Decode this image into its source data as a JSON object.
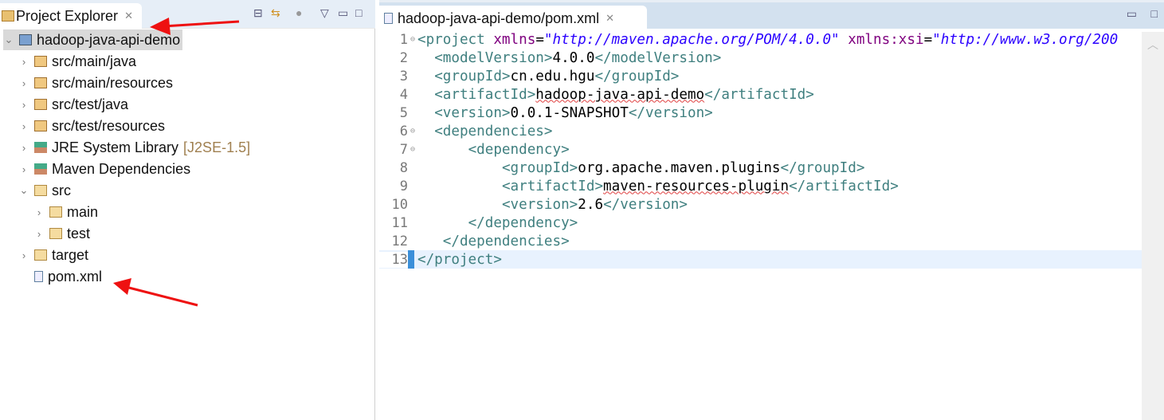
{
  "explorer": {
    "title": "Project Explorer",
    "items": [
      {
        "label": "hadoop-java-api-demo",
        "depth": 0,
        "expanded": true,
        "icon": "maven-project-icon",
        "selected": true
      },
      {
        "label": "src/main/java",
        "depth": 1,
        "expanded": false,
        "icon": "package-folder-icon"
      },
      {
        "label": "src/main/resources",
        "depth": 1,
        "expanded": false,
        "icon": "package-folder-icon"
      },
      {
        "label": "src/test/java",
        "depth": 1,
        "expanded": false,
        "icon": "package-folder-icon"
      },
      {
        "label": "src/test/resources",
        "depth": 1,
        "expanded": false,
        "icon": "package-folder-icon"
      },
      {
        "label": "JRE System Library",
        "suffix": "[J2SE-1.5]",
        "depth": 1,
        "expanded": false,
        "icon": "library-icon"
      },
      {
        "label": "Maven Dependencies",
        "depth": 1,
        "expanded": false,
        "icon": "library-icon"
      },
      {
        "label": "src",
        "depth": 1,
        "expanded": true,
        "icon": "folder-icon"
      },
      {
        "label": "main",
        "depth": 2,
        "expanded": false,
        "icon": "folder-icon"
      },
      {
        "label": "test",
        "depth": 2,
        "expanded": false,
        "icon": "folder-icon"
      },
      {
        "label": "target",
        "depth": 1,
        "expanded": false,
        "icon": "folder-icon"
      },
      {
        "label": "pom.xml",
        "depth": 1,
        "icon": "xml-file-icon"
      }
    ]
  },
  "editor": {
    "tab_label": "hadoop-java-api-demo/pom.xml",
    "lines": [
      {
        "n": "1",
        "fold": true,
        "tokens": [
          [
            "tag",
            "<project "
          ],
          [
            "att",
            "xmlns"
          ],
          [
            "pl",
            "="
          ],
          [
            "str",
            "\"http://maven.apache.org/POM/4.0.0\""
          ],
          [
            "pl",
            " "
          ],
          [
            "att",
            "xmlns:xsi"
          ],
          [
            "pl",
            "="
          ],
          [
            "str",
            "\"http://www.w3.org/200"
          ]
        ]
      },
      {
        "n": "2",
        "tokens": [
          [
            "pl",
            "  "
          ],
          [
            "tag",
            "<modelVersion>"
          ],
          [
            "pl",
            "4.0.0"
          ],
          [
            "tag",
            "</modelVersion>"
          ]
        ]
      },
      {
        "n": "3",
        "tokens": [
          [
            "pl",
            "  "
          ],
          [
            "tag",
            "<groupId>"
          ],
          [
            "pl",
            "cn.edu.hgu"
          ],
          [
            "tag",
            "</groupId>"
          ]
        ]
      },
      {
        "n": "4",
        "tokens": [
          [
            "pl",
            "  "
          ],
          [
            "tag",
            "<artifactId>"
          ],
          [
            "sq",
            "hadoop-java-api-demo"
          ],
          [
            "tag",
            "</artifactId>"
          ]
        ]
      },
      {
        "n": "5",
        "tokens": [
          [
            "pl",
            "  "
          ],
          [
            "tag",
            "<version>"
          ],
          [
            "pl",
            "0.0.1-SNAPSHOT"
          ],
          [
            "tag",
            "</version>"
          ]
        ]
      },
      {
        "n": "6",
        "fold": true,
        "tokens": [
          [
            "pl",
            "  "
          ],
          [
            "tag",
            "<dependencies>"
          ]
        ]
      },
      {
        "n": "7",
        "fold": true,
        "tokens": [
          [
            "pl",
            "      "
          ],
          [
            "tag",
            "<dependency>"
          ]
        ]
      },
      {
        "n": "8",
        "tokens": [
          [
            "pl",
            "          "
          ],
          [
            "tag",
            "<groupId>"
          ],
          [
            "pl",
            "org.apache.maven.plugins"
          ],
          [
            "tag",
            "</groupId>"
          ]
        ]
      },
      {
        "n": "9",
        "tokens": [
          [
            "pl",
            "          "
          ],
          [
            "tag",
            "<artifactId>"
          ],
          [
            "sq",
            "maven-resources-plugin"
          ],
          [
            "tag",
            "</artifactId>"
          ]
        ]
      },
      {
        "n": "10",
        "tokens": [
          [
            "pl",
            "          "
          ],
          [
            "tag",
            "<version>"
          ],
          [
            "pl",
            "2.6"
          ],
          [
            "tag",
            "</version>"
          ]
        ]
      },
      {
        "n": "11",
        "tokens": [
          [
            "pl",
            "      "
          ],
          [
            "tag",
            "</dependency>"
          ]
        ]
      },
      {
        "n": "12",
        "tokens": [
          [
            "pl",
            "   "
          ],
          [
            "tag",
            "</dependencies>"
          ]
        ]
      },
      {
        "n": "13",
        "current": true,
        "tokens": [
          [
            "tag",
            "</project>"
          ]
        ]
      }
    ]
  },
  "colors": {
    "tag": "#3f7f7f",
    "attribute": "#7f007f",
    "string": "#2a00ff",
    "annotation_arrow": "#ee1111"
  }
}
